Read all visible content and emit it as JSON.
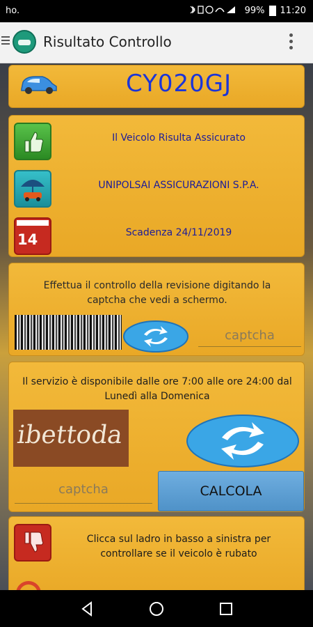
{
  "status_bar": {
    "carrier": "ho.",
    "battery": "99%",
    "time": "11:20"
  },
  "app_bar": {
    "title": "Risultato Controllo",
    "menu_icon": "hamburger-menu-icon",
    "overflow_icon": "more-vertical-icon"
  },
  "plate_card": {
    "plate": "CY020GJ",
    "icon": "car-icon"
  },
  "info_card": {
    "status": "Il Veicolo Risulta Assicurato",
    "insurer": "UNIPOLSAI ASSICURAZIONI S.P.A.",
    "expiry": "Scadenza 24/11/2019",
    "calendar_day": "14",
    "icons": [
      "thumbs-up-icon",
      "umbrella-car-icon",
      "calendar-icon"
    ]
  },
  "revision_card": {
    "message": "Effettua il controllo della revisione digitando la captcha che vedi a schermo.",
    "captcha_placeholder": "captcha"
  },
  "service_card": {
    "message": "Il servizio è disponibile dalle ore 7:00 alle ore 24:00 dal Lunedì alla Domenica",
    "captcha_text": "ibettoda",
    "captcha_placeholder": "captcha",
    "calc_label": "CALCOLA"
  },
  "theft_card": {
    "message": "Clicca sul ladro in basso a sinistra per controllare se il veicolo è rubato",
    "icon": "thumbs-down-icon"
  },
  "colors": {
    "card": "#f2b93a",
    "plate_text": "#1b35d8",
    "info_text": "#1c1c9a",
    "calc_button": "#5fa0d4"
  }
}
